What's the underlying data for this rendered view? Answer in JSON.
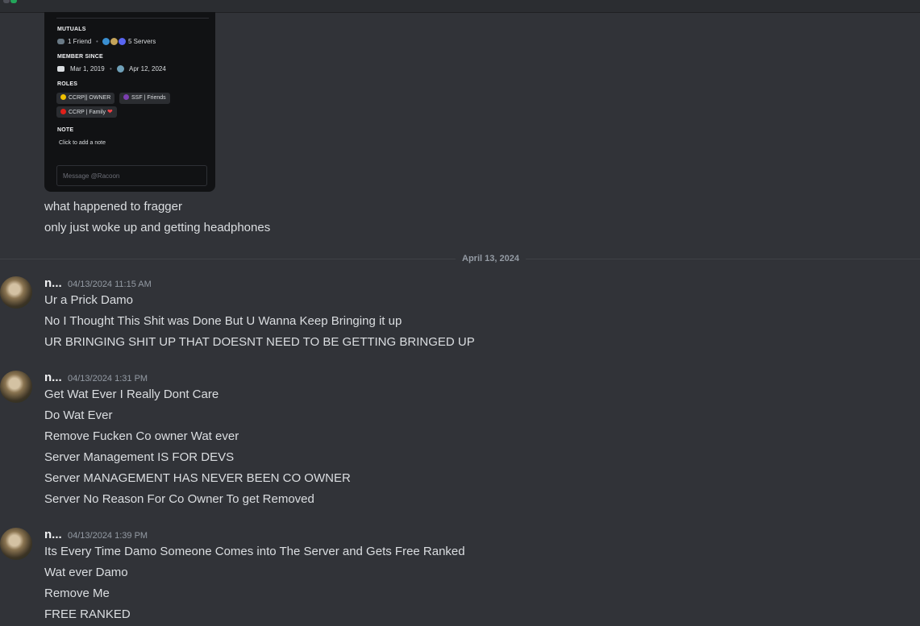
{
  "profile_card": {
    "mutuals_heading": "MUTUALS",
    "mutual_friends": "1 Friend",
    "mutual_servers": "5 Servers",
    "member_since_heading": "MEMBER SINCE",
    "discord_since": "Mar 1, 2019",
    "server_since": "Apr 12, 2024",
    "roles_heading": "ROLES",
    "roles": [
      {
        "label": "CCRP|| OWNER",
        "color": "#f0c000"
      },
      {
        "label": "SSF | Friends",
        "color": "#7b3fb0"
      },
      {
        "label": "CCRP | Family",
        "color": "#e0201a"
      }
    ],
    "note_heading": "NOTE",
    "note_placeholder": "Click to add a note",
    "message_placeholder": "Message @Racoon"
  },
  "prior_messages": [
    "what happened to fragger",
    "only just woke up and getting headphones"
  ],
  "date_divider": "April 13, 2024",
  "groups": [
    {
      "username": "n...",
      "timestamp": "04/13/2024 11:15 AM",
      "lines": [
        "Ur a Prick Damo",
        "No I Thought This Shit was Done But U Wanna Keep Bringing it up",
        "UR BRINGING SHIT UP THAT DOESNT NEED TO BE GETTING BRINGED UP"
      ]
    },
    {
      "username": "n...",
      "timestamp": "04/13/2024 1:31 PM",
      "lines": [
        "Get Wat Ever I Really Dont Care",
        "Do Wat Ever",
        "Remove Fucken Co owner Wat ever",
        "Server Management IS FOR DEVS",
        "Server MANAGEMENT HAS NEVER BEEN CO OWNER",
        "Server No Reason For Co Owner To get Removed"
      ]
    },
    {
      "username": "n...",
      "timestamp": "04/13/2024 1:39 PM",
      "lines": [
        "Its Every Time Damo Someone Comes into The Server and Gets Free Ranked",
        "Wat ever Damo",
        "Remove Me",
        "FREE RANKED"
      ]
    }
  ],
  "colors": {
    "background": "#313338",
    "card": "#111214",
    "text": "#dbdee1",
    "muted": "#949ba4",
    "heart": "#f23f43"
  }
}
